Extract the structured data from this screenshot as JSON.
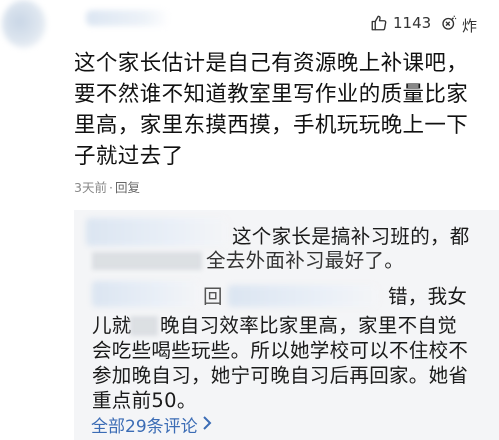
{
  "header": {
    "like_count": "1143",
    "bomb_label": "炸",
    "icons": [
      "thumbs-up-icon",
      "bomb-icon"
    ]
  },
  "comment": {
    "text": "这个家长估计是自己有资源晚上补课吧，要不然谁不知道教室里写作业的质量比家里高，家里东摸西摸，手机玩玩晚上一下子就过去了",
    "time": "3天前",
    "reply_label": "回复"
  },
  "replies": {
    "reply1_line1": "这个家长是搞补习班的，都",
    "reply1_line2": "全去外面补习最好了。",
    "reply2_frag_a": "回",
    "reply2_frag_b": "错，我女",
    "reply2_frag_c": "儿就",
    "reply2_line2": "晚自习效率比家里高，家里不自觉",
    "reply2_line3": "会吃些喝些玩些。所以她学校可以不住校不",
    "reply2_line4": "参加晚自习，她宁可晚自习后再回家。她省",
    "reply2_line5": "重点前50。",
    "more_label": "全部29条评论",
    "more_icon": "chevron-right-icon"
  }
}
